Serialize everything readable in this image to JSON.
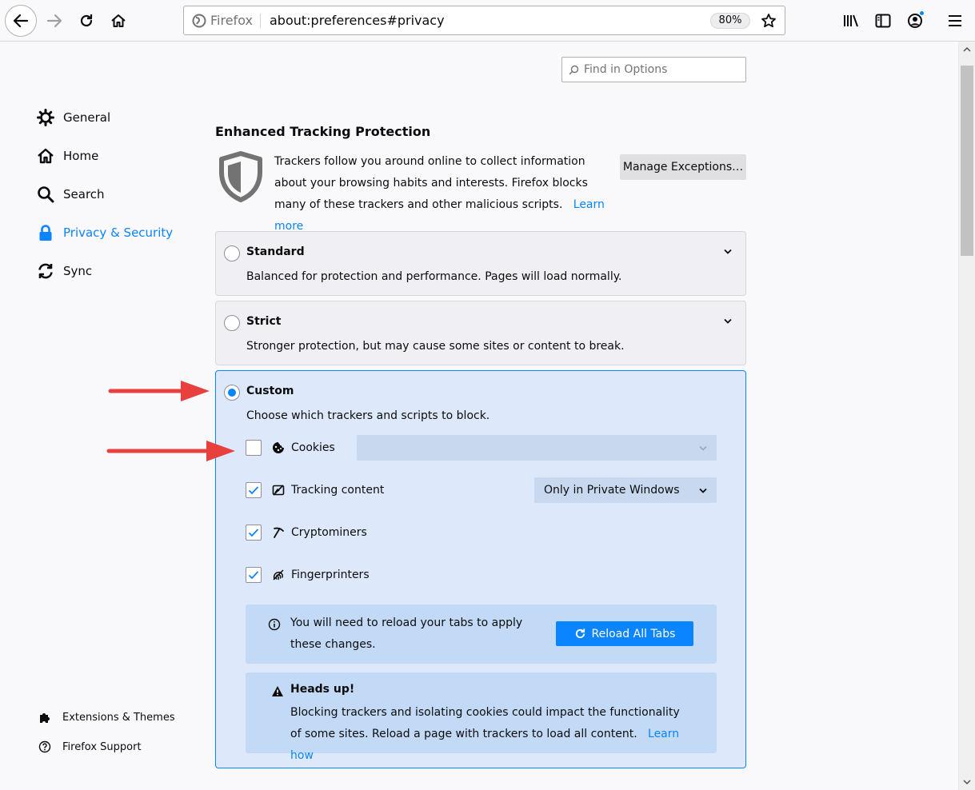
{
  "toolbar": {
    "identity_label": "Firefox",
    "url": "about:preferences#privacy",
    "zoom": "80%"
  },
  "search": {
    "placeholder": "Find in Options"
  },
  "nav": {
    "items": [
      {
        "label": "General",
        "icon": "gear-icon"
      },
      {
        "label": "Home",
        "icon": "home-icon"
      },
      {
        "label": "Search",
        "icon": "search-icon"
      },
      {
        "label": "Privacy & Security",
        "icon": "lock-icon",
        "selected": true
      },
      {
        "label": "Sync",
        "icon": "sync-icon"
      }
    ],
    "footer": [
      {
        "label": "Extensions & Themes",
        "icon": "puzzle-icon"
      },
      {
        "label": "Firefox Support",
        "icon": "help-icon"
      }
    ]
  },
  "etp": {
    "title": "Enhanced Tracking Protection",
    "description": "Trackers follow you around online to collect information about your browsing habits and interests. Firefox blocks many of these trackers and other malicious scripts.",
    "learn_more": "Learn more",
    "manage_exceptions": "Manage Exceptions…",
    "standard": {
      "title": "Standard",
      "desc": "Balanced for protection and performance. Pages will load normally."
    },
    "strict": {
      "title": "Strict",
      "desc": "Stronger protection, but may cause some sites or content to break."
    },
    "custom": {
      "title": "Custom",
      "desc": "Choose which trackers and scripts to block.",
      "options": [
        {
          "label": "Cookies",
          "checked": false,
          "icon": "cookie-icon"
        },
        {
          "label": "Tracking content",
          "checked": true,
          "icon": "tracking-content-icon",
          "select_value": "Only in Private Windows"
        },
        {
          "label": "Cryptominers",
          "checked": true,
          "icon": "cryptominer-icon"
        },
        {
          "label": "Fingerprinters",
          "checked": true,
          "icon": "fingerprint-icon"
        }
      ],
      "reload_notice": "You will need to reload your tabs to apply these changes.",
      "reload_button": "Reload All Tabs",
      "warning_title": "Heads up!",
      "warning_text": "Blocking trackers and isolating cookies could impact the functionality of some sites. Reload a page with trackers to load all content.",
      "learn_how": "Learn how"
    }
  },
  "colors": {
    "accent": "#0a84ff",
    "annotation_arrow": "#e8403c"
  }
}
